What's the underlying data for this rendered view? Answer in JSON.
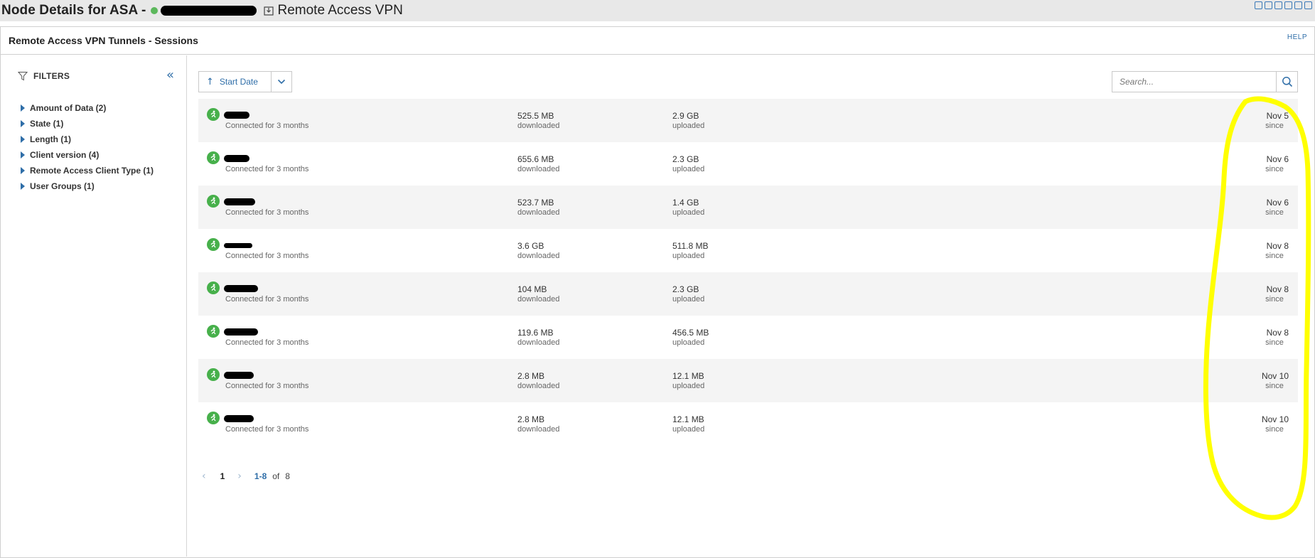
{
  "header": {
    "title_prefix": "Node Details for ASA -",
    "page_name": "Remote Access VPN"
  },
  "panel": {
    "title": "Remote Access VPN Tunnels - Sessions",
    "help": "HELP"
  },
  "filters": {
    "label": "FILTERS",
    "items": [
      {
        "label": "Amount of Data (2)"
      },
      {
        "label": "State (1)"
      },
      {
        "label": "Length (1)"
      },
      {
        "label": "Client version (4)"
      },
      {
        "label": "Remote Access Client Type (1)"
      },
      {
        "label": "User Groups (1)"
      }
    ]
  },
  "toolbar": {
    "sort_label": "Start Date",
    "search_placeholder": "Search..."
  },
  "sessions": [
    {
      "connected": "Connected for 3 months",
      "downloaded": "525.5 MB",
      "downloaded_label": "downloaded",
      "uploaded": "2.9 GB",
      "uploaded_label": "uploaded",
      "since": "Nov 5",
      "since_label": "since"
    },
    {
      "connected": "Connected for 3 months",
      "downloaded": "655.6 MB",
      "downloaded_label": "downloaded",
      "uploaded": "2.3 GB",
      "uploaded_label": "uploaded",
      "since": "Nov 6",
      "since_label": "since"
    },
    {
      "connected": "Connected for 3 months",
      "downloaded": "523.7 MB",
      "downloaded_label": "downloaded",
      "uploaded": "1.4 GB",
      "uploaded_label": "uploaded",
      "since": "Nov 6",
      "since_label": "since"
    },
    {
      "connected": "Connected for 3 months",
      "downloaded": "3.6 GB",
      "downloaded_label": "downloaded",
      "uploaded": "511.8 MB",
      "uploaded_label": "uploaded",
      "since": "Nov 8",
      "since_label": "since"
    },
    {
      "connected": "Connected for 3 months",
      "downloaded": "104 MB",
      "downloaded_label": "downloaded",
      "uploaded": "2.3 GB",
      "uploaded_label": "uploaded",
      "since": "Nov 8",
      "since_label": "since"
    },
    {
      "connected": "Connected for 3 months",
      "downloaded": "119.6 MB",
      "downloaded_label": "downloaded",
      "uploaded": "456.5 MB",
      "uploaded_label": "uploaded",
      "since": "Nov 8",
      "since_label": "since"
    },
    {
      "connected": "Connected for 3 months",
      "downloaded": "2.8 MB",
      "downloaded_label": "downloaded",
      "uploaded": "12.1 MB",
      "uploaded_label": "uploaded",
      "since": "Nov 10",
      "since_label": "since"
    },
    {
      "connected": "Connected for 3 months",
      "downloaded": "2.8 MB",
      "downloaded_label": "downloaded",
      "uploaded": "12.1 MB",
      "uploaded_label": "uploaded",
      "since": "Nov 10",
      "since_label": "since"
    }
  ],
  "pagination": {
    "page": "1",
    "range": "1-8",
    "of": "of",
    "total": "8"
  },
  "colors": {
    "accent": "#2f6ea8",
    "status_green": "#47b04b",
    "annotation": "#ffff00"
  },
  "icons": {
    "status": "status-dot",
    "filter": "funnel-icon",
    "collapse": "double-chevron-left-icon",
    "sort": "arrow-up-icon",
    "dropdown": "chevron-down-icon",
    "search": "search-icon",
    "user": "vpn-user-icon"
  }
}
